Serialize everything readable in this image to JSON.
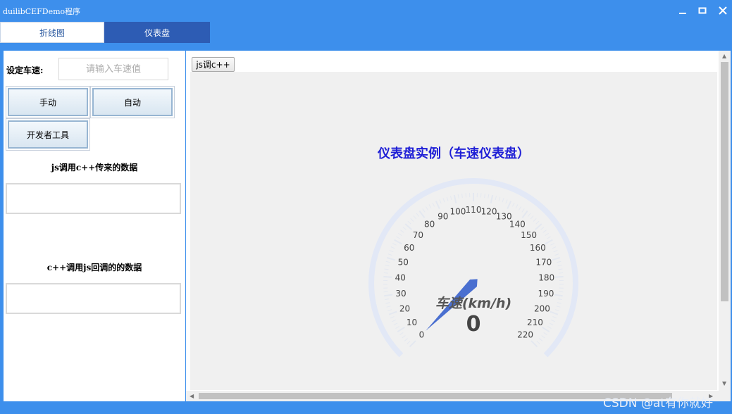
{
  "window": {
    "title": "duilibCEFDemo程序",
    "controls": [
      "minimize-icon",
      "maximize-icon",
      "close-icon"
    ]
  },
  "tabs": [
    {
      "label": "折线图",
      "selected": false
    },
    {
      "label": "仪表盘",
      "selected": true
    }
  ],
  "left": {
    "speed_label": "设定车速:",
    "speed_input": {
      "value": "",
      "placeholder": "请输入车速值"
    },
    "buttons": {
      "manual": "手动",
      "auto": "自动",
      "devtools": "开发者工具"
    },
    "js_to_cpp_label": "js调用c++传来的数据",
    "cpp_to_js_label": "c++调用js回调的的数据"
  },
  "right": {
    "js_call_button": "js调c++",
    "gauge": {
      "title": "仪表盘实例（车速仪表盘）",
      "name": "车速(km/h)",
      "value": "0",
      "min": 0,
      "max": 220,
      "tick_labels": [
        "0",
        "10",
        "20",
        "30",
        "40",
        "50",
        "60",
        "70",
        "80",
        "90",
        "100",
        "110",
        "120",
        "130",
        "140",
        "150",
        "160",
        "170",
        "180",
        "190",
        "200",
        "210",
        "220"
      ]
    }
  },
  "colors": {
    "titlebar": "#3d8fec",
    "tab_selected": "#2d5cb4",
    "gauge_title": "#1f1fd6",
    "pointer": "#4a6fd0",
    "gauge_band": "#e2e8f6"
  },
  "watermark": "CSDN @at有你就好"
}
